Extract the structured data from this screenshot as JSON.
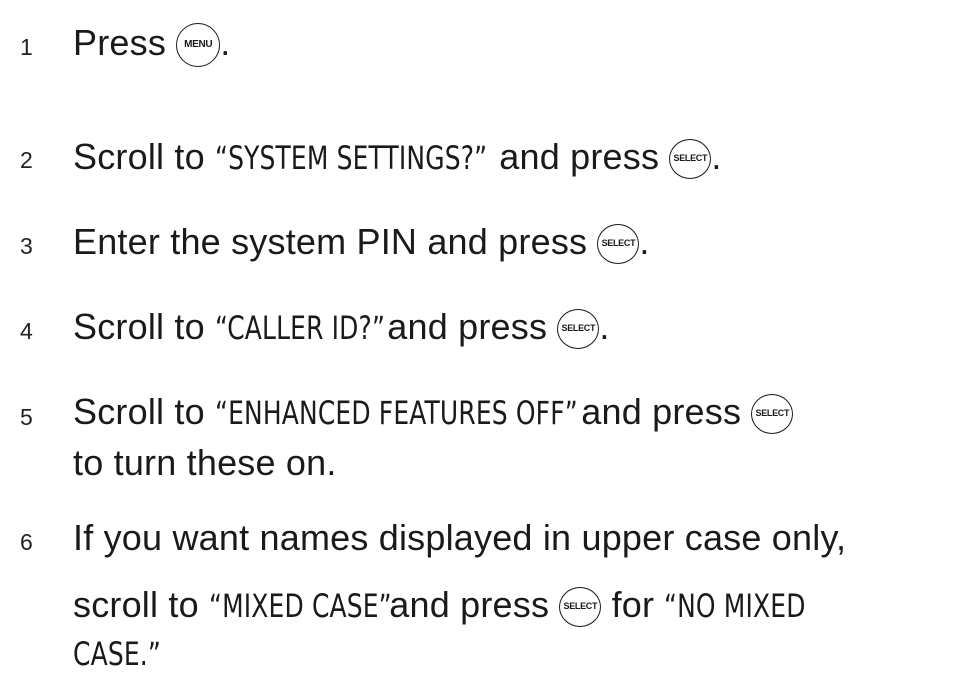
{
  "steps": [
    {
      "number": "1",
      "parts": [
        "Press",
        "MENU",
        "."
      ]
    },
    {
      "number": "2",
      "parts": [
        "Scroll to",
        "“SYSTEM SETTINGS?”",
        "and press",
        "SELECT",
        "."
      ]
    },
    {
      "number": "3",
      "parts": [
        "Enter the system PIN and press",
        "SELECT",
        "."
      ]
    },
    {
      "number": "4",
      "parts": [
        "Scroll to",
        "“CALLER ID?”",
        "and press",
        "SELECT",
        "."
      ]
    },
    {
      "number": "5",
      "parts": [
        "Scroll to",
        "“ENHANCED FEATURES OFF”",
        "and press",
        "SELECT",
        "to turn these on."
      ]
    },
    {
      "number": "6",
      "parts": [
        "If you want names displayed in upper case only,",
        "scroll to",
        "“MIXED CASE”",
        "and press",
        "SELECT",
        "for",
        "“NO MIXED",
        "CASE.”"
      ]
    }
  ]
}
